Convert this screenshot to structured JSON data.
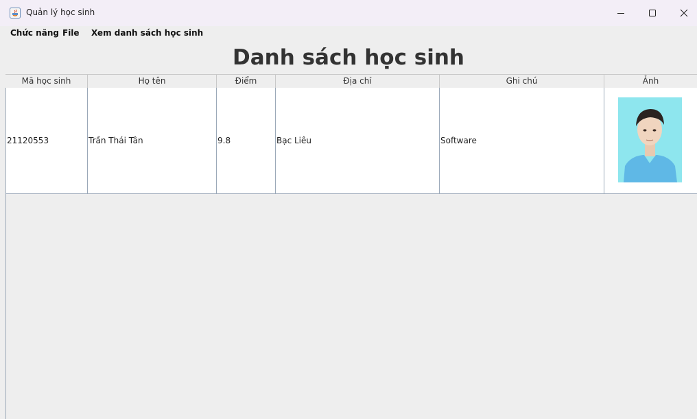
{
  "window": {
    "title": "Quản lý học sinh"
  },
  "menu": {
    "items": [
      "Chức năng",
      "File",
      "Xem danh sách học sinh"
    ]
  },
  "heading": "Danh sách học sinh",
  "table": {
    "columns": [
      "Mã học sinh",
      "Họ tên",
      "Điểm",
      "Địa chỉ",
      "Ghi chú",
      "Ảnh"
    ],
    "rows": [
      {
        "id": "21120553",
        "name": "Trần Thái Tân",
        "score": "9.8",
        "address": "Bạc Liêu",
        "note": "Software",
        "photo": "student-photo"
      }
    ]
  },
  "colors": {
    "titlebar": "#f3eef7",
    "background": "#eeeeee",
    "grid": "#9aa8b8",
    "photo_bg": "#8ee6ee"
  }
}
